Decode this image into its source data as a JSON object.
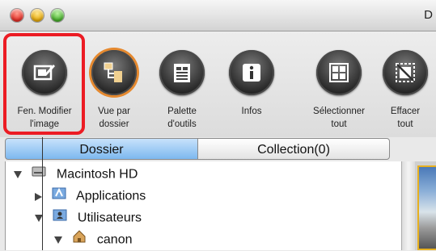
{
  "window": {
    "title_fragment": "D"
  },
  "toolbar": {
    "items": [
      {
        "label_line1": "Fen. Modifier",
        "label_line2": "l'image",
        "icon": "edit-image-icon"
      },
      {
        "label_line1": "Vue par",
        "label_line2": "dossier",
        "icon": "folder-view-icon"
      },
      {
        "label_line1": "Palette",
        "label_line2": "d'outils",
        "icon": "tool-palette-icon"
      },
      {
        "label_line1": "Infos",
        "label_line2": "",
        "icon": "info-icon"
      },
      {
        "label_line1": "Sélectionner",
        "label_line2": "tout",
        "icon": "select-all-icon"
      },
      {
        "label_line1": "Effacer",
        "label_line2": "tout",
        "icon": "clear-all-icon"
      }
    ]
  },
  "tabs": {
    "folder": "Dossier",
    "collection": "Collection(0)"
  },
  "tree": {
    "items": [
      {
        "label": "Macintosh HD",
        "expanded": true,
        "icon": "hard-drive-icon"
      },
      {
        "label": "Applications",
        "expanded": false,
        "icon": "applications-folder-icon"
      },
      {
        "label": "Utilisateurs",
        "expanded": true,
        "icon": "users-folder-icon"
      },
      {
        "label": "canon",
        "expanded": true,
        "icon": "home-icon"
      }
    ]
  },
  "colors": {
    "highlight": "#ec1c24",
    "active_tab": "#7db8ef",
    "orange_ring": "#e5892f"
  }
}
